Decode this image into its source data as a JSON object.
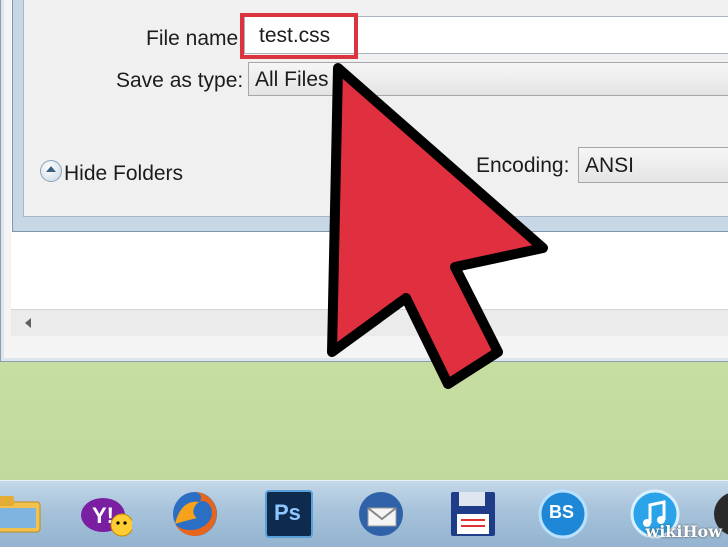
{
  "dialog": {
    "file_name_label": "File name:",
    "file_name_value": "test.css",
    "save_as_type_label": "Save as type:",
    "save_as_type_value": "All Files",
    "hide_folders_label": "Hide Folders",
    "encoding_label": "Encoding:",
    "encoding_value": "ANSI"
  },
  "annotation": {
    "highlight_color": "#d9343f",
    "arrow_color": "#e0303f"
  },
  "taskbar": {
    "icons": [
      "windows-explorer-icon",
      "yahoo-messenger-icon",
      "firefox-icon",
      "photoshop-icon",
      "thunderbird-icon",
      "save-floppy-icon",
      "bs-player-icon",
      "itunes-icon"
    ],
    "photoshop_label": "Ps",
    "bs_label": "BS"
  },
  "watermark": "wikiHow"
}
